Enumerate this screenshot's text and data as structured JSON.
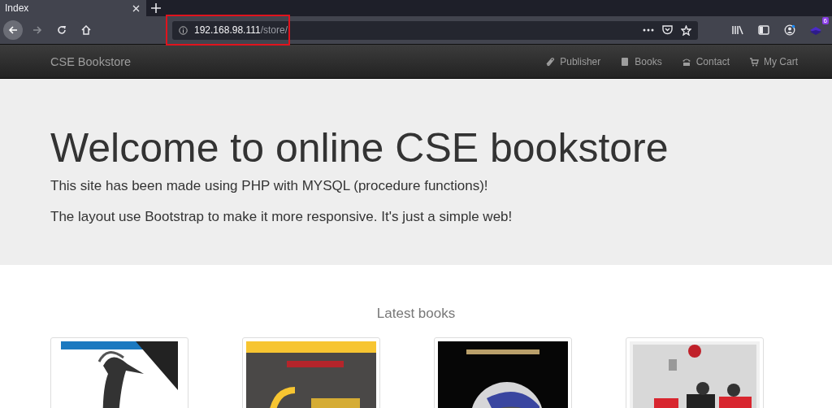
{
  "browser": {
    "tab": {
      "title": "Index",
      "selected": true
    },
    "address_bar": {
      "host": "192.168.98.111",
      "path": "/store/",
      "highlighted": true
    },
    "extension_badge": "6"
  },
  "navbar": {
    "brand": "CSE Bookstore",
    "links": [
      {
        "label": "Publisher"
      },
      {
        "label": "Books"
      },
      {
        "label": "Contact"
      },
      {
        "label": "My Cart"
      }
    ]
  },
  "hero": {
    "title": "Welcome to online CSE bookstore",
    "lines": [
      "This site has been made using PHP with MYSQL (procedure functions)!",
      "The layout use Bootstrap to make it more responsive. It's just a simple web!"
    ]
  },
  "latest": {
    "heading": "Latest books"
  }
}
